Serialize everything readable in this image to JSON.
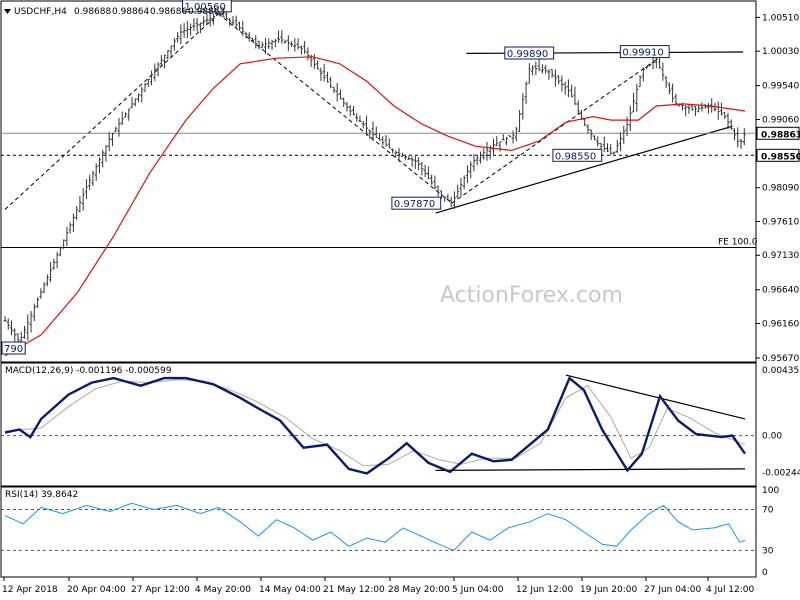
{
  "chart_data": [
    {
      "type": "candlestick",
      "panel": "price",
      "header": {
        "symbol": "USDCHF,H4",
        "ohlc": [
          "0.98688",
          "0.98864",
          "0.98686",
          "0.98863"
        ]
      },
      "watermark": "ActionForex.com",
      "yaxis": {
        "ticks": [
          "1.00510",
          "1.00030",
          "0.99540",
          "0.99060",
          "0.98580",
          "0.98090",
          "0.97610",
          "0.97130",
          "0.96640",
          "0.96160",
          "0.95670"
        ],
        "range": [
          0.9567,
          1.007
        ]
      },
      "xaxis": {
        "ticks": [
          "12 Apr 2018",
          "20 Apr 04:00",
          "27 Apr 12:00",
          "4 May 20:00",
          "14 May 04:00",
          "21 May 12:00",
          "28 May 20:00",
          "5 Jun 04:00",
          "12 Jun 12:00",
          "19 Jun 20:00",
          "27 Jun 04:00",
          "4 Jul 12:00"
        ]
      },
      "price_path": [
        {
          "t": 0,
          "p": 0.962
        },
        {
          "t": 8,
          "p": 0.959
        },
        {
          "t": 18,
          "p": 0.965
        },
        {
          "t": 30,
          "p": 0.972
        },
        {
          "t": 45,
          "p": 0.981
        },
        {
          "t": 58,
          "p": 0.988
        },
        {
          "t": 72,
          "p": 0.9935
        },
        {
          "t": 85,
          "p": 0.9985
        },
        {
          "t": 97,
          "p": 1.003
        },
        {
          "t": 110,
          "p": 1.0045
        },
        {
          "t": 118,
          "p": 1.0056
        },
        {
          "t": 128,
          "p": 1.004
        },
        {
          "t": 140,
          "p": 1.001
        },
        {
          "t": 152,
          "p": 1.002
        },
        {
          "t": 165,
          "p": 1.0005
        },
        {
          "t": 178,
          "p": 0.996
        },
        {
          "t": 190,
          "p": 0.992
        },
        {
          "t": 203,
          "p": 0.9885
        },
        {
          "t": 215,
          "p": 0.986
        },
        {
          "t": 228,
          "p": 0.9845
        },
        {
          "t": 240,
          "p": 0.98
        },
        {
          "t": 247,
          "p": 0.9787
        },
        {
          "t": 258,
          "p": 0.9845
        },
        {
          "t": 270,
          "p": 0.987
        },
        {
          "t": 282,
          "p": 0.9885
        },
        {
          "t": 290,
          "p": 0.998
        },
        {
          "t": 300,
          "p": 0.9975
        },
        {
          "t": 312,
          "p": 0.9945
        },
        {
          "t": 320,
          "p": 0.99
        },
        {
          "t": 328,
          "p": 0.987
        },
        {
          "t": 336,
          "p": 0.9856
        },
        {
          "t": 344,
          "p": 0.99
        },
        {
          "t": 352,
          "p": 0.9975
        },
        {
          "t": 360,
          "p": 0.9991
        },
        {
          "t": 370,
          "p": 0.993
        },
        {
          "t": 380,
          "p": 0.992
        },
        {
          "t": 390,
          "p": 0.9925
        },
        {
          "t": 398,
          "p": 0.991
        },
        {
          "t": 406,
          "p": 0.987
        },
        {
          "t": 409,
          "p": 0.98863
        }
      ],
      "t_max": 409,
      "ema": [
        {
          "t": 0,
          "p": 0.957
        },
        {
          "t": 20,
          "p": 0.96
        },
        {
          "t": 40,
          "p": 0.966
        },
        {
          "t": 60,
          "p": 0.974
        },
        {
          "t": 80,
          "p": 0.983
        },
        {
          "t": 100,
          "p": 0.9905
        },
        {
          "t": 115,
          "p": 0.995
        },
        {
          "t": 130,
          "p": 0.9985
        },
        {
          "t": 150,
          "p": 0.9993
        },
        {
          "t": 170,
          "p": 0.9995
        },
        {
          "t": 185,
          "p": 0.9985
        },
        {
          "t": 200,
          "p": 0.996
        },
        {
          "t": 215,
          "p": 0.9925
        },
        {
          "t": 230,
          "p": 0.99
        },
        {
          "t": 245,
          "p": 0.9882
        },
        {
          "t": 260,
          "p": 0.9868
        },
        {
          "t": 280,
          "p": 0.9862
        },
        {
          "t": 295,
          "p": 0.9875
        },
        {
          "t": 310,
          "p": 0.9902
        },
        {
          "t": 325,
          "p": 0.991
        },
        {
          "t": 335,
          "p": 0.9905
        },
        {
          "t": 350,
          "p": 0.9905
        },
        {
          "t": 360,
          "p": 0.9925
        },
        {
          "t": 375,
          "p": 0.9928
        },
        {
          "t": 390,
          "p": 0.9925
        },
        {
          "t": 409,
          "p": 0.9918
        }
      ],
      "annotations": [
        {
          "label": "1.00560",
          "t": 118,
          "p": 1.0056
        },
        {
          "label": "0.99890",
          "t": 305,
          "p": 0.9989
        },
        {
          "label": "0.99910",
          "t": 360,
          "p": 0.9991
        },
        {
          "label": "0.97870",
          "t": 247,
          "p": 0.9787
        },
        {
          "label": "0.98550",
          "t": 336,
          "p": 0.9855
        },
        {
          "label": "790"
        }
      ],
      "levels": [
        {
          "label": "0.98863",
          "p": 0.98863
        },
        {
          "label": "0.98550",
          "p": 0.9855
        },
        {
          "label": "FE 100.0",
          "p": 0.9724
        }
      ],
      "trendlines": [
        {
          "t1": 238,
          "p1": 0.9773,
          "t2": 402,
          "p2": 0.98963
        },
        {
          "t1": 255,
          "p1": 0.99998,
          "t2": 408,
          "p2": 1.00018
        }
      ]
    },
    {
      "type": "line",
      "panel": "macd",
      "header": "MACD(12,26,9) -0.001196 -0.000599",
      "yaxis": {
        "ticks": [
          "0.004351",
          "0.00",
          "-0.002448"
        ],
        "range": [
          -0.0032,
          0.0046
        ]
      },
      "macd": [
        {
          "t": 0,
          "v": 0.0002
        },
        {
          "t": 8,
          "v": 0.0004
        },
        {
          "t": 14,
          "v": -0.0001
        },
        {
          "t": 20,
          "v": 0.0011
        },
        {
          "t": 35,
          "v": 0.0027
        },
        {
          "t": 48,
          "v": 0.0035
        },
        {
          "t": 60,
          "v": 0.0038
        },
        {
          "t": 75,
          "v": 0.0033
        },
        {
          "t": 88,
          "v": 0.0038
        },
        {
          "t": 100,
          "v": 0.0038
        },
        {
          "t": 115,
          "v": 0.0034
        },
        {
          "t": 130,
          "v": 0.0025
        },
        {
          "t": 140,
          "v": 0.0018
        },
        {
          "t": 152,
          "v": 0.001
        },
        {
          "t": 165,
          "v": -0.0008
        },
        {
          "t": 178,
          "v": -0.0006
        },
        {
          "t": 190,
          "v": -0.0022
        },
        {
          "t": 200,
          "v": -0.0025
        },
        {
          "t": 212,
          "v": -0.0015
        },
        {
          "t": 222,
          "v": -0.0005
        },
        {
          "t": 234,
          "v": -0.0018
        },
        {
          "t": 246,
          "v": -0.0024
        },
        {
          "t": 258,
          "v": -0.0012
        },
        {
          "t": 270,
          "v": -0.0017
        },
        {
          "t": 280,
          "v": -0.0016
        },
        {
          "t": 290,
          "v": -0.0006
        },
        {
          "t": 300,
          "v": 0.0004
        },
        {
          "t": 312,
          "v": 0.0038
        },
        {
          "t": 320,
          "v": 0.003
        },
        {
          "t": 330,
          "v": 0.0004
        },
        {
          "t": 344,
          "v": -0.0023
        },
        {
          "t": 352,
          "v": -0.0012
        },
        {
          "t": 362,
          "v": 0.0026
        },
        {
          "t": 372,
          "v": 0.001
        },
        {
          "t": 382,
          "v": 0.0001
        },
        {
          "t": 396,
          "v": -0.0001
        },
        {
          "t": 402,
          "v": 0.0
        },
        {
          "t": 409,
          "v": -0.0012
        }
      ],
      "signal": [
        {
          "t": 0,
          "v": 0.0003
        },
        {
          "t": 20,
          "v": 0.0005
        },
        {
          "t": 35,
          "v": 0.0019
        },
        {
          "t": 50,
          "v": 0.0031
        },
        {
          "t": 65,
          "v": 0.0036
        },
        {
          "t": 80,
          "v": 0.0035
        },
        {
          "t": 95,
          "v": 0.0037
        },
        {
          "t": 110,
          "v": 0.0036
        },
        {
          "t": 125,
          "v": 0.003
        },
        {
          "t": 140,
          "v": 0.0022
        },
        {
          "t": 155,
          "v": 0.0012
        },
        {
          "t": 170,
          "v": -0.0002
        },
        {
          "t": 185,
          "v": -0.001
        },
        {
          "t": 198,
          "v": -0.002
        },
        {
          "t": 212,
          "v": -0.0019
        },
        {
          "t": 226,
          "v": -0.001
        },
        {
          "t": 240,
          "v": -0.0016
        },
        {
          "t": 252,
          "v": -0.0019
        },
        {
          "t": 266,
          "v": -0.0015
        },
        {
          "t": 282,
          "v": -0.0015
        },
        {
          "t": 296,
          "v": -0.0005
        },
        {
          "t": 310,
          "v": 0.0025
        },
        {
          "t": 322,
          "v": 0.0033
        },
        {
          "t": 335,
          "v": 0.0012
        },
        {
          "t": 346,
          "v": -0.0015
        },
        {
          "t": 356,
          "v": -0.0008
        },
        {
          "t": 366,
          "v": 0.0018
        },
        {
          "t": 378,
          "v": 0.0012
        },
        {
          "t": 392,
          "v": 0.0002
        },
        {
          "t": 409,
          "v": -0.0006
        }
      ],
      "trendlines": [
        {
          "t1": 238,
          "v1": -0.0023,
          "t2": 409,
          "v2": -0.0022
        },
        {
          "t1": 310,
          "v1": 0.004,
          "t2": 409,
          "v2": 0.0011
        }
      ]
    },
    {
      "type": "line",
      "panel": "rsi",
      "header": "RSI(14) 39.8642",
      "yaxis": {
        "ticks": [
          "70",
          "30"
        ],
        "range": [
          5,
          90
        ]
      },
      "scale_ticks": [
        "100",
        "0"
      ],
      "rsi": [
        {
          "t": 0,
          "v": 64
        },
        {
          "t": 10,
          "v": 56
        },
        {
          "t": 20,
          "v": 72
        },
        {
          "t": 32,
          "v": 66
        },
        {
          "t": 45,
          "v": 74
        },
        {
          "t": 58,
          "v": 68
        },
        {
          "t": 70,
          "v": 76
        },
        {
          "t": 82,
          "v": 70
        },
        {
          "t": 95,
          "v": 74
        },
        {
          "t": 108,
          "v": 66
        },
        {
          "t": 118,
          "v": 72
        },
        {
          "t": 130,
          "v": 58
        },
        {
          "t": 140,
          "v": 44
        },
        {
          "t": 150,
          "v": 60
        },
        {
          "t": 160,
          "v": 52
        },
        {
          "t": 170,
          "v": 40
        },
        {
          "t": 180,
          "v": 48
        },
        {
          "t": 190,
          "v": 34
        },
        {
          "t": 200,
          "v": 42
        },
        {
          "t": 210,
          "v": 38
        },
        {
          "t": 220,
          "v": 52
        },
        {
          "t": 230,
          "v": 44
        },
        {
          "t": 240,
          "v": 36
        },
        {
          "t": 248,
          "v": 30
        },
        {
          "t": 258,
          "v": 48
        },
        {
          "t": 268,
          "v": 40
        },
        {
          "t": 278,
          "v": 52
        },
        {
          "t": 290,
          "v": 58
        },
        {
          "t": 300,
          "v": 66
        },
        {
          "t": 310,
          "v": 60
        },
        {
          "t": 320,
          "v": 48
        },
        {
          "t": 330,
          "v": 36
        },
        {
          "t": 338,
          "v": 34
        },
        {
          "t": 346,
          "v": 50
        },
        {
          "t": 356,
          "v": 66
        },
        {
          "t": 364,
          "v": 74
        },
        {
          "t": 372,
          "v": 58
        },
        {
          "t": 380,
          "v": 50
        },
        {
          "t": 392,
          "v": 52
        },
        {
          "t": 400,
          "v": 56
        },
        {
          "t": 406,
          "v": 38
        },
        {
          "t": 409,
          "v": 39.86
        }
      ]
    }
  ]
}
